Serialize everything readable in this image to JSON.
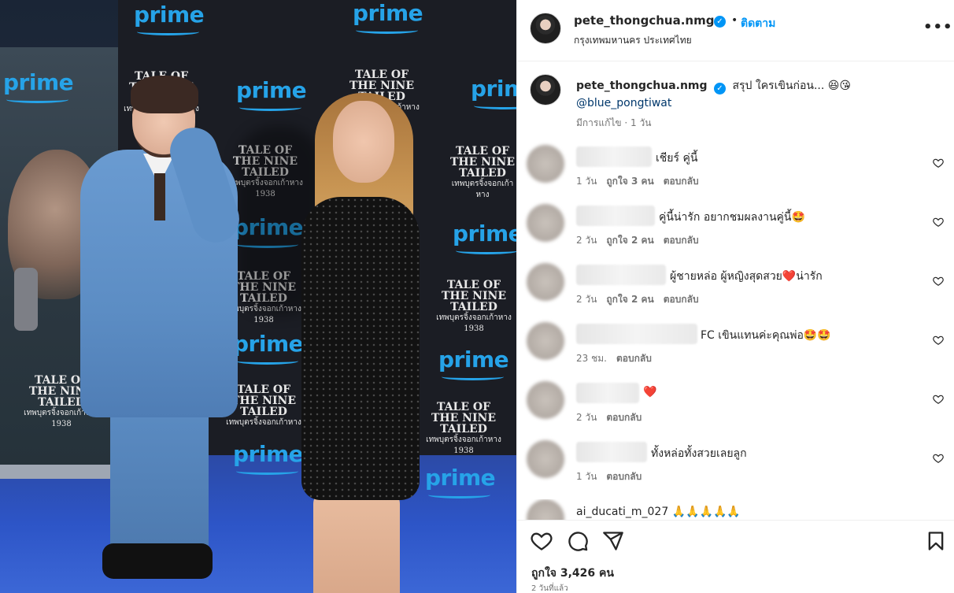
{
  "post": {
    "username": "pete_thongchua.nmg",
    "follow_label": "ติดตาม",
    "separator": "•",
    "location": "กรุงเทพมหานคร ประเทศไทย",
    "more_label": "•••"
  },
  "photo_logos": {
    "prime": "prime",
    "show_title_line1": "TALE OF",
    "show_title_line2": "THE NINE TAILED",
    "show_title_thai": "เทพบุตรจิ้งจอกเก้าหาง",
    "show_title_year": "1938"
  },
  "caption": {
    "username": "pete_thongchua.nmg",
    "text": "สรุป ใครเขินก่อน... 😆😘",
    "mention": "@blue_pongtiwat",
    "meta": "มีการแก้ไข · 1 วัน"
  },
  "comments": [
    {
      "text": "เชียร์ คู่นี้",
      "time": "1 วัน",
      "likes": "ถูกใจ 3 คน",
      "reply": "ตอบกลับ"
    },
    {
      "text": "คู่นี้น่ารัก อยากชมผลงานคู่นี้🤩",
      "time": "2 วัน",
      "likes": "ถูกใจ 2 คน",
      "reply": "ตอบกลับ"
    },
    {
      "text": "ผู้ชายหล่อ ผู้หญิงสุดสวย❤️น่ารัก",
      "time": "2 วัน",
      "likes": "ถูกใจ 2 คน",
      "reply": "ตอบกลับ"
    },
    {
      "text": "FC เขินแทนค่ะคุณพ่อ🤩🤩",
      "time": "23 ชม.",
      "likes": "",
      "reply": "ตอบกลับ"
    },
    {
      "text": "❤️",
      "time": "2 วัน",
      "likes": "",
      "reply": "ตอบกลับ"
    },
    {
      "text": "ทั้งหล่อทั้งสวยเลยลูก",
      "time": "1 วัน",
      "likes": "",
      "reply": "ตอบกลับ"
    },
    {
      "text": "ai_ducati_m_027 🙏🙏🙏🙏🙏",
      "time": "",
      "likes": "",
      "reply": ""
    }
  ],
  "footer": {
    "likes": "ถูกใจ 3,426 คน",
    "time": "2 วันที่แล้ว"
  },
  "icons": [
    "heart-icon",
    "comment-icon",
    "share-icon",
    "save-icon",
    "verified-icon"
  ],
  "colors": {
    "link": "#0095f6",
    "mention": "#00376b",
    "muted": "#737373",
    "text": "#262626",
    "prime_blue": "#26a3e8"
  }
}
